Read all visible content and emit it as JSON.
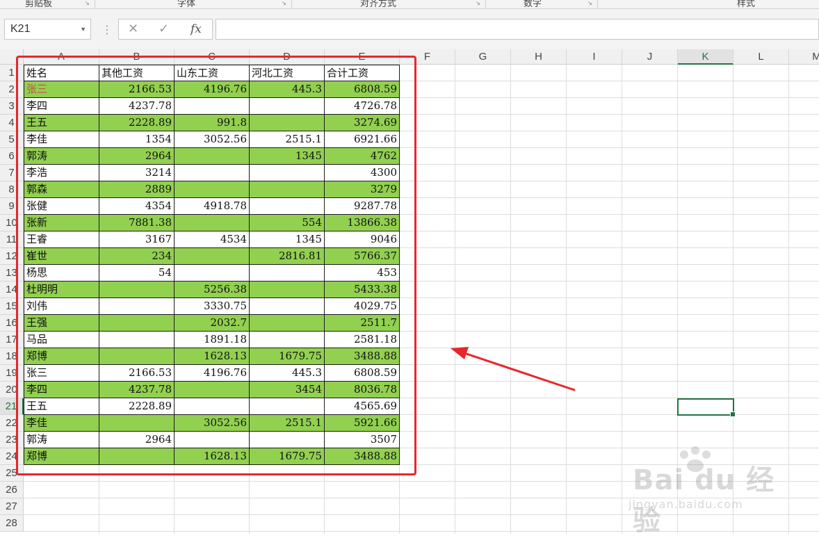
{
  "ribbon": {
    "groups": [
      "剪贴板",
      "字体",
      "对齐方式",
      "数字",
      "样式"
    ]
  },
  "formula_bar": {
    "name_box": "K21",
    "cancel_glyph": "✕",
    "enter_glyph": "✓",
    "fx_label": "fx",
    "formula": ""
  },
  "columns": [
    "A",
    "B",
    "C",
    "D",
    "E",
    "F",
    "G",
    "H",
    "I",
    "J",
    "K",
    "L",
    "M"
  ],
  "selected_column": "K",
  "rows": [
    "1",
    "2",
    "3",
    "4",
    "5",
    "6",
    "7",
    "8",
    "9",
    "10",
    "11",
    "12",
    "13",
    "14",
    "15",
    "16",
    "17",
    "18",
    "19",
    "20",
    "21",
    "22",
    "23",
    "24",
    "25",
    "26",
    "27",
    "28"
  ],
  "selected_row": "21",
  "table": {
    "header": [
      "姓名",
      "其他工资",
      "山东工资",
      "河北工资",
      "合计工资"
    ],
    "rows": [
      {
        "cells": [
          "张三",
          "2166.53",
          "4196.76",
          "445.3",
          "6808.59"
        ],
        "green": true,
        "name_red": true
      },
      {
        "cells": [
          "李四",
          "4237.78",
          "",
          "",
          "4726.78"
        ],
        "green": false
      },
      {
        "cells": [
          "王五",
          "2228.89",
          "991.8",
          "",
          "3274.69"
        ],
        "green": true
      },
      {
        "cells": [
          "李佳",
          "1354",
          "3052.56",
          "2515.1",
          "6921.66"
        ],
        "green": false
      },
      {
        "cells": [
          "郭涛",
          "2964",
          "",
          "1345",
          "4762"
        ],
        "green": true
      },
      {
        "cells": [
          "李浩",
          "3214",
          "",
          "",
          "4300"
        ],
        "green": false
      },
      {
        "cells": [
          "郭森",
          "2889",
          "",
          "",
          "3279"
        ],
        "green": true
      },
      {
        "cells": [
          "张健",
          "4354",
          "4918.78",
          "",
          "9287.78"
        ],
        "green": false
      },
      {
        "cells": [
          "张新",
          "7881.38",
          "",
          "554",
          "13866.38"
        ],
        "green": true
      },
      {
        "cells": [
          "王睿",
          "3167",
          "4534",
          "1345",
          "9046"
        ],
        "green": false
      },
      {
        "cells": [
          "崔世",
          "234",
          "",
          "2816.81",
          "5766.37"
        ],
        "green": true
      },
      {
        "cells": [
          "杨思",
          "54",
          "",
          "",
          "453"
        ],
        "green": false
      },
      {
        "cells": [
          "杜明明",
          "",
          "5256.38",
          "",
          "5433.38"
        ],
        "green": true
      },
      {
        "cells": [
          "刘伟",
          "",
          "3330.75",
          "",
          "4029.75"
        ],
        "green": false
      },
      {
        "cells": [
          "王强",
          "",
          "2032.7",
          "",
          "2511.7"
        ],
        "green": true
      },
      {
        "cells": [
          "马品",
          "",
          "1891.18",
          "",
          "2581.18"
        ],
        "green": false
      },
      {
        "cells": [
          "郑博",
          "",
          "1628.13",
          "1679.75",
          "3488.88"
        ],
        "green": true
      },
      {
        "cells": [
          "张三",
          "2166.53",
          "4196.76",
          "445.3",
          "6808.59"
        ],
        "green": false
      },
      {
        "cells": [
          "李四",
          "4237.78",
          "",
          "3454",
          "8036.78"
        ],
        "green": true
      },
      {
        "cells": [
          "王五",
          "2228.89",
          "",
          "",
          "4565.69"
        ],
        "green": false
      },
      {
        "cells": [
          "李佳",
          "",
          "3052.56",
          "2515.1",
          "5921.66"
        ],
        "green": true
      },
      {
        "cells": [
          "郭涛",
          "2964",
          "",
          "",
          "3507"
        ],
        "green": false
      },
      {
        "cells": [
          "郑博",
          "",
          "1628.13",
          "1679.75",
          "3488.88"
        ],
        "green": true
      }
    ]
  },
  "colors": {
    "green_fill": "#92d050",
    "annotation_red": "#e8262b",
    "selection_green": "#217346",
    "name_red": "#c0504d"
  },
  "watermark": {
    "logo_text": "Bai du 经验",
    "url_text": "jingyan.baidu.com"
  }
}
